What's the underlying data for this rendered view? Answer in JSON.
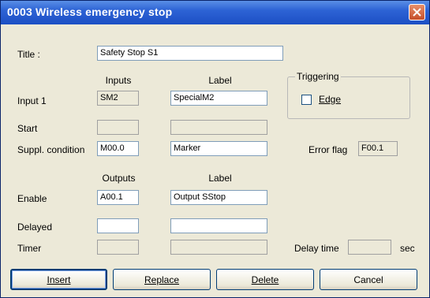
{
  "window": {
    "title": "0003  Wireless emergency stop"
  },
  "labels": {
    "title": "Title :",
    "input1": "Input 1",
    "start": "Start",
    "suppl": "Suppl. condition",
    "enable": "Enable",
    "delayed": "Delayed",
    "timer": "Timer",
    "error_flag": "Error flag",
    "delay_time": "Delay time",
    "sec": "sec"
  },
  "headers": {
    "inputs": "Inputs",
    "label_top": "Label",
    "outputs": "Outputs",
    "label_bottom": "Label"
  },
  "fields": {
    "title": "Safety Stop S1",
    "input1_input": "SM2",
    "input1_label": "SpecialM2",
    "start_input": "",
    "start_label": "",
    "suppl_input": "M00.0",
    "suppl_label": "Marker",
    "error_flag": "F00.1",
    "enable_output": "A00.1",
    "enable_label": "Output SStop",
    "delayed_output": "",
    "delayed_label": "",
    "timer_output": "",
    "timer_label": "",
    "delay_time": ""
  },
  "triggering": {
    "group_title": "Triggering",
    "edge_label": "Edge",
    "edge_checked": false
  },
  "buttons": {
    "insert": "Insert",
    "replace": "Replace",
    "delete": "Delete",
    "cancel": "Cancel"
  }
}
